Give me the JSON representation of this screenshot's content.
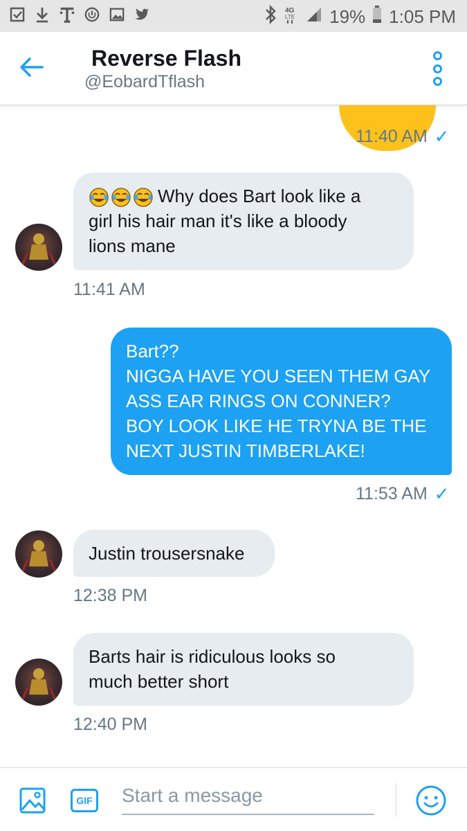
{
  "status_bar": {
    "battery": "19%",
    "time": "1:05 PM",
    "network": "4G LTE",
    "left_icons": [
      "checkbox-icon",
      "download-icon",
      "t-mobile-icon",
      "power-save-icon",
      "image-icon",
      "twitter-icon"
    ],
    "right_icons": [
      "bluetooth-icon",
      "network-icon",
      "signal-icon",
      "battery-icon"
    ]
  },
  "header": {
    "name": "Reverse Flash",
    "handle": "@EobardTflash"
  },
  "messages": [
    {
      "type": "sent-partial",
      "time": "11:40 AM"
    },
    {
      "type": "received",
      "lines": [
        "Why does Bart look like a",
        "girl his hair man it's like a bloody",
        "lions mane"
      ],
      "emoji": [
        "face-with-tears-of-joy",
        "face-with-tears-of-joy",
        "face-with-tears-of-joy"
      ],
      "time": "11:41 AM"
    },
    {
      "type": "sent",
      "lines": [
        "Bart??",
        "NIGGA HAVE YOU SEEN THEM GAY",
        "ASS EAR RINGS ON CONNER?",
        "BOY LOOK LIKE HE TRYNA BE THE",
        "NEXT JUSTIN TIMBERLAKE!"
      ],
      "time": "11:53 AM"
    },
    {
      "type": "received",
      "lines": [
        "Justin trousersnake"
      ],
      "time": "12:38 PM"
    },
    {
      "type": "received",
      "lines": [
        "Barts hair is ridiculous looks so",
        "much better short"
      ],
      "time": "12:40 PM"
    }
  ],
  "composer": {
    "placeholder": "Start a message",
    "gif_label": "GIF"
  },
  "colors": {
    "accent": "#1da1f2",
    "incoming_bubble": "#e6ecf0",
    "muted_text": "#657786",
    "status_bar_bg": "#e6e6e6"
  }
}
